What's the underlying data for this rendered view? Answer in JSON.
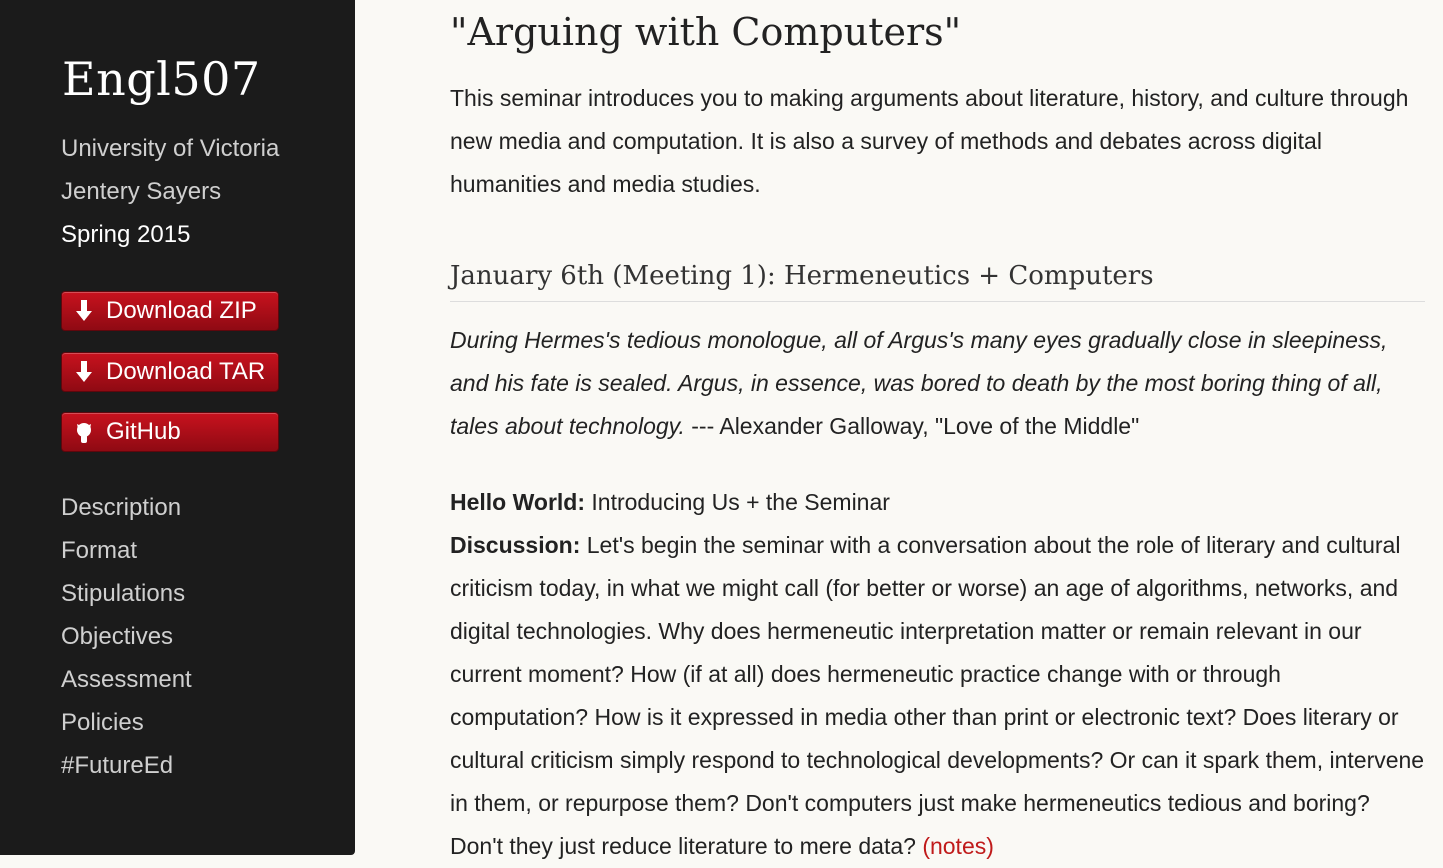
{
  "sidebar": {
    "title": "Engl507",
    "institution": "University of Victoria",
    "instructor": "Jentery Sayers",
    "term": "Spring 2015",
    "buttons": [
      {
        "label": "Download ZIP",
        "icon": "download-arrow-icon"
      },
      {
        "label": "Download TAR",
        "icon": "download-arrow-icon"
      },
      {
        "label": "GitHub",
        "icon": "github-octocat-icon"
      }
    ],
    "nav": [
      "Description",
      "Format",
      "Stipulations",
      "Objectives",
      "Assessment",
      "Policies",
      "#FutureEd"
    ]
  },
  "main": {
    "title": "\"Arguing with Computers\"",
    "intro": "This seminar introduces you to making arguments about literature, history, and culture through new media and computation. It is also a survey of methods and debates across digital humanities and media studies.",
    "meeting_heading": "January 6th (Meeting 1): Hermeneutics + Computers",
    "quote_text": "During Hermes's tedious monologue, all of Argus's many eyes gradually close in sleepiness, and his fate is sealed. Argus, in essence, was bored to death by the most boring thing of all, tales about technology.",
    "quote_attribution": " --- Alexander Galloway, \"Love of the Middle\"",
    "hello_label": "Hello World:",
    "hello_text": " Introducing Us + the Seminar",
    "discussion_label": "Discussion:",
    "discussion_text": " Let's begin the seminar with a conversation about the role of literary and cultural criticism today, in what we might call (for better or worse) an age of algorithms, networks, and digital technologies. Why does hermeneutic interpretation matter or remain relevant in our current moment? How (if at all) does hermeneutic practice change with or through computation? How is it expressed in media other than print or electronic text? Does literary or cultural criticism simply respond to technological developments? Or can it spark them, intervene in them, or repurpose them? Don't computers just make hermeneutics tedious and boring? Don't they just reduce literature to mere data? ",
    "notes_link": "(notes)"
  },
  "colors": {
    "sidebar_bg": "#1b1b1b",
    "button_red": "#b20f1a",
    "link_red": "#c01a1a",
    "page_bg": "#faf9f5"
  }
}
